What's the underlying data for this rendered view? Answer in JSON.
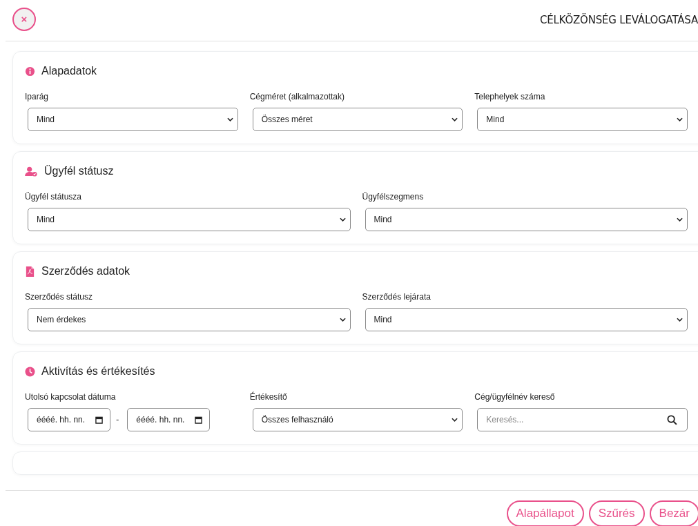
{
  "header": {
    "close_label": "×",
    "title": "CÉLKÖZÖNSÉG LEVÁLOGATÁSA"
  },
  "sections": [
    {
      "title": "Alapadatok",
      "fields": [
        {
          "kind": "select",
          "label": "Iparág",
          "value": "Mind"
        },
        {
          "kind": "select",
          "label": "Cégméret (alkalmazottak)",
          "value": "Összes méret"
        },
        {
          "kind": "select",
          "label": "Telephelyek száma",
          "value": "Mind"
        }
      ]
    },
    {
      "title": "Ügyfél státusz",
      "fields": [
        {
          "kind": "select",
          "label": "Ügyfél státusza",
          "value": "Mind"
        },
        {
          "kind": "select",
          "label": "Ügyfélszegmens",
          "value": "Mind"
        }
      ]
    },
    {
      "title": "Szerződés adatok",
      "fields": [
        {
          "kind": "select",
          "label": "Szerződés státusz",
          "value": "Nem érdekes"
        },
        {
          "kind": "select",
          "label": "Szerződés lejárata",
          "value": "Mind"
        }
      ]
    },
    {
      "title": "Aktivítás és értékesítés",
      "fields": [
        {
          "kind": "daterange",
          "label": "Utolsó kapcsolat dátuma",
          "from": "éééé. hh. nn.",
          "separator": "-",
          "to": "éééé. hh. nn."
        },
        {
          "kind": "select",
          "label": "Értékesítő",
          "value": "Összes felhasználó"
        },
        {
          "kind": "search",
          "label": "Cég/ügyfélnév kereső",
          "placeholder": "Keresés..."
        }
      ]
    }
  ],
  "buttons": [
    "Alapállapot",
    "Szűrés",
    "Bezár"
  ]
}
